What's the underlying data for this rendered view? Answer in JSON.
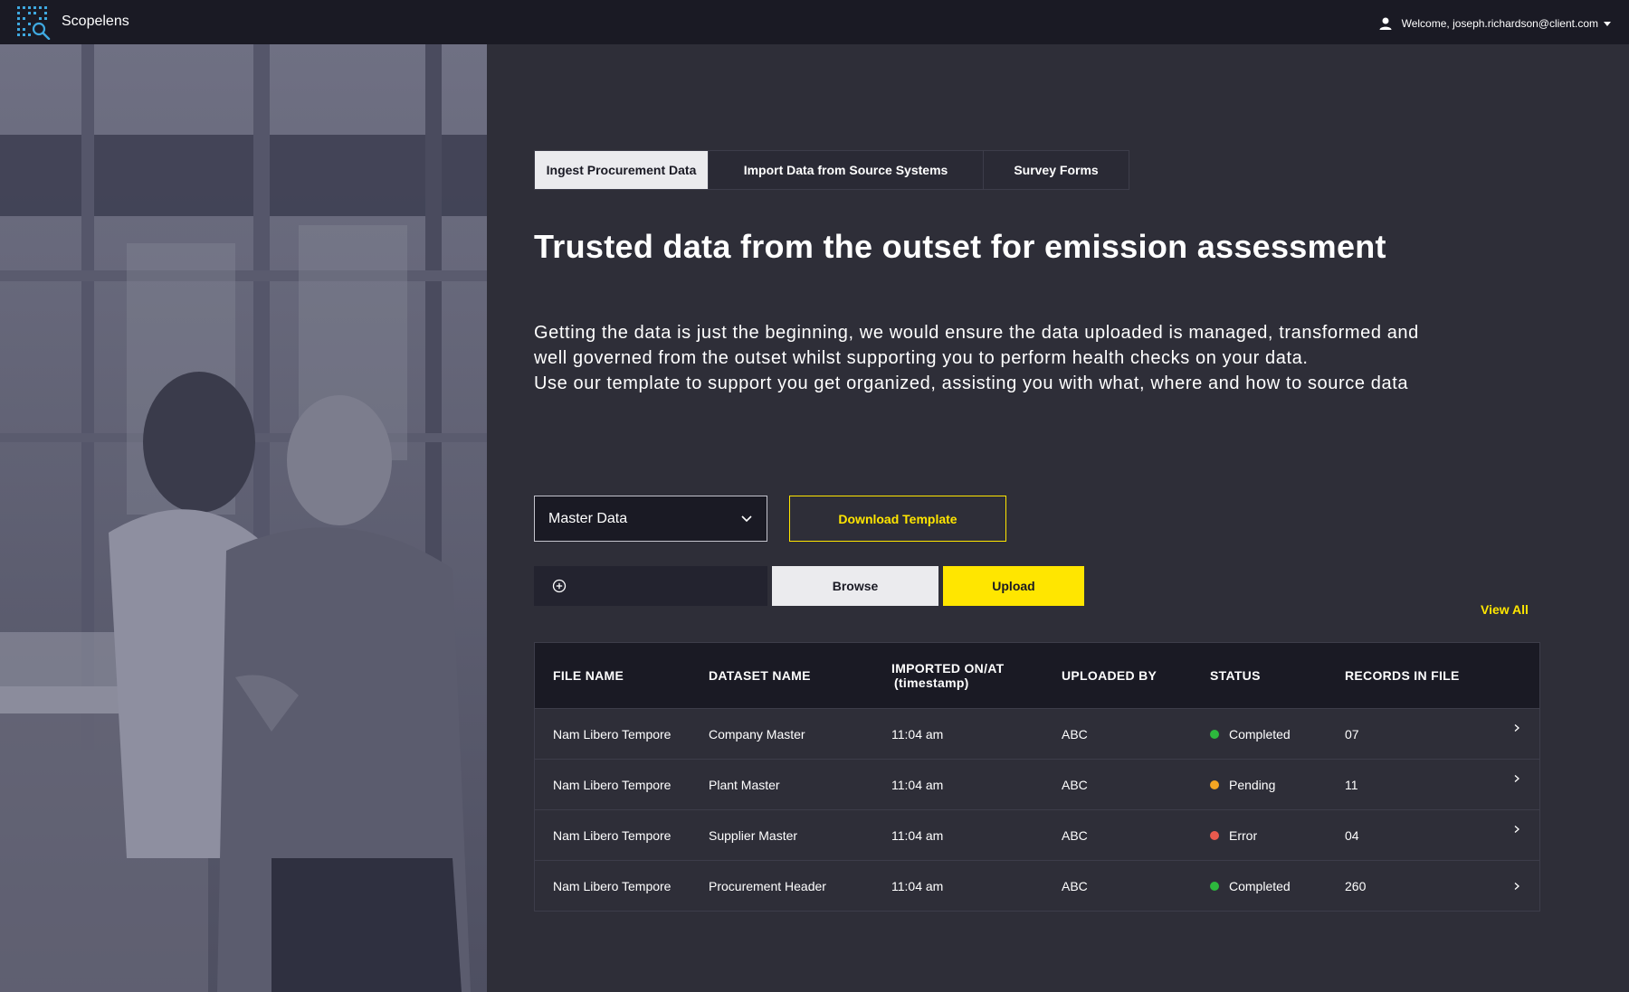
{
  "app": {
    "brand": "Scopelens"
  },
  "user": {
    "welcome": "Welcome, joseph.richardson@client.com"
  },
  "tabs": [
    {
      "label": "Ingest Procurement Data",
      "active": true
    },
    {
      "label": "Import Data from Source Systems",
      "active": false
    },
    {
      "label": "Survey Forms",
      "active": false
    }
  ],
  "heading": "Trusted data from the outset for emission assessment",
  "description": {
    "line1": "Getting the data is just the beginning, we would ensure the data uploaded is managed, transformed and well governed from the outset whilst supporting you to perform health checks on your data.",
    "line2": "Use our template to support you get organized, assisting you with what, where and how to source data"
  },
  "controls": {
    "dataset_select": "Master Data",
    "download_label": "Download Template",
    "browse_label": "Browse",
    "upload_label": "Upload",
    "view_all_label": "View All"
  },
  "table": {
    "headers": {
      "file_name": "FILE NAME",
      "dataset_name": "DATASET NAME",
      "imported_on": "IMPORTED ON/AT",
      "imported_on_sub": "(timestamp)",
      "uploaded_by": "UPLOADED BY",
      "status": "STATUS",
      "records": "RECORDS IN FILE"
    },
    "rows": [
      {
        "file_name": "Nam Libero Tempore",
        "dataset": "Company Master",
        "time": "11:04 am",
        "uploaded_by": "ABC",
        "status": "Completed",
        "status_color": "#2db83d",
        "records": "07"
      },
      {
        "file_name": "Nam Libero Tempore",
        "dataset": "Plant Master",
        "time": "11:04 am",
        "uploaded_by": "ABC",
        "status": "Pending",
        "status_color": "#f5a623",
        "records": "11"
      },
      {
        "file_name": "Nam Libero Tempore",
        "dataset": "Supplier Master",
        "time": "11:04 am",
        "uploaded_by": "ABC",
        "status": "Error",
        "status_color": "#ea5a4e",
        "records": "04"
      },
      {
        "file_name": "Nam Libero Tempore",
        "dataset": "Procurement Header",
        "time": "11:04 am",
        "uploaded_by": "ABC",
        "status": "Completed",
        "status_color": "#2db83d",
        "records": "260"
      }
    ]
  },
  "colors": {
    "accent": "#ffe600",
    "topbar": "#1a1a24",
    "background": "#2e2e38"
  },
  "icons": [
    "scopelens-logo-icon",
    "user-icon",
    "caret-down-icon",
    "chevron-down-icon",
    "add-circle-icon",
    "chevron-right-icon"
  ]
}
